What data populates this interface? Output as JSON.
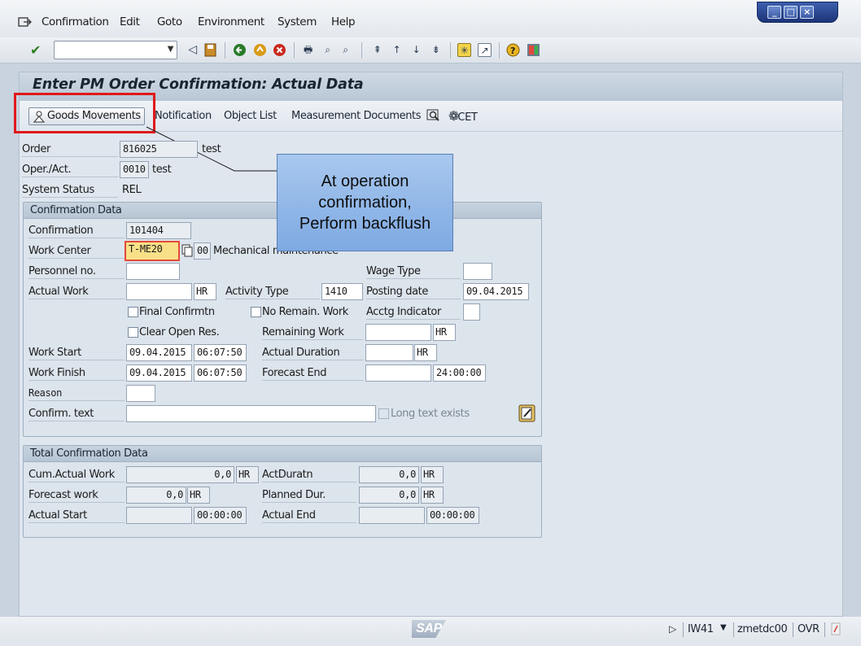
{
  "menu": [
    "Confirmation",
    "Edit",
    "Goto",
    "Environment",
    "System",
    "Help"
  ],
  "window_controls": [
    "minimize-icon",
    "restore-icon",
    "close-icon"
  ],
  "title": "Enter PM Order Confirmation: Actual Data",
  "app_toolbar": {
    "goods_movements": "Goods Movements",
    "notification": "Notification",
    "object_list": "Object List",
    "measurement_documents": "Measurement Documents",
    "cet": "CET"
  },
  "header": {
    "order_label": "Order",
    "order_value": "816025",
    "order_text": "test",
    "operact_label": "Oper./Act.",
    "operact_value": "0010",
    "operact_text": "test",
    "status_label": "System Status",
    "status_value": "REL"
  },
  "callout": {
    "line1": "At operation",
    "line2": "confirmation,",
    "line3": "Perform backflush"
  },
  "confirmation_data": {
    "header": "Confirmation Data",
    "confirmation_label": "Confirmation",
    "confirmation_value": "101404",
    "work_center_label": "Work Center",
    "work_center_value": "T-ME20",
    "plant_value": "00",
    "work_center_text": "Mechanical maintenance",
    "personnel_label": "Personnel no.",
    "personnel_value": "",
    "wage_type_label": "Wage Type",
    "wage_type_value": "",
    "actual_work_label": "Actual Work",
    "actual_work_value": "",
    "actual_work_unit": "HR",
    "activity_type_label": "Activity Type",
    "activity_type_value": "1410",
    "posting_date_label": "Posting date",
    "posting_date_value": "09.04.2015",
    "final_confirmation": "Final Confirmtn",
    "no_remain_work": "No Remain. Work",
    "acctg_indicator_label": "Acctg Indicator",
    "acctg_indicator_value": "",
    "clear_open_res": "Clear Open Res.",
    "remaining_work_label": "Remaining Work",
    "remaining_work_value": "",
    "remaining_work_unit": "HR",
    "work_start_label": "Work Start",
    "work_start_date": "09.04.2015",
    "work_start_time": "06:07:50",
    "actual_duration_label": "Actual Duration",
    "actual_duration_value": "",
    "actual_duration_unit": "HR",
    "work_finish_label": "Work Finish",
    "work_finish_date": "09.04.2015",
    "work_finish_time": "06:07:50",
    "forecast_end_label": "Forecast End",
    "forecast_end_date": "",
    "forecast_end_time": "24:00:00",
    "reason_label": "Reason",
    "reason_value": "",
    "confirm_text_label": "Confirm. text",
    "confirm_text_value": "",
    "long_text_exists": "Long text exists"
  },
  "total_confirmation_data": {
    "header": "Total Confirmation Data",
    "cum_actual_work_label": "Cum.Actual Work",
    "cum_actual_work_value": "0,0",
    "cum_actual_work_unit": "HR",
    "act_duration_label": "ActDuratn",
    "act_duration_value": "0,0",
    "act_duration_unit": "HR",
    "forecast_work_label": "Forecast work",
    "forecast_work_value": "0,0",
    "forecast_work_unit": "HR",
    "planned_dur_label": "Planned Dur.",
    "planned_dur_value": "0,0",
    "planned_dur_unit": "HR",
    "actual_start_label": "Actual Start",
    "actual_start_date": "",
    "actual_start_time": "00:00:00",
    "actual_end_label": "Actual End",
    "actual_end_date": "",
    "actual_end_time": "00:00:00"
  },
  "status_bar": {
    "transaction": "IW41",
    "user": "zmetdc00",
    "mode": "OVR",
    "logo": "SAP"
  }
}
